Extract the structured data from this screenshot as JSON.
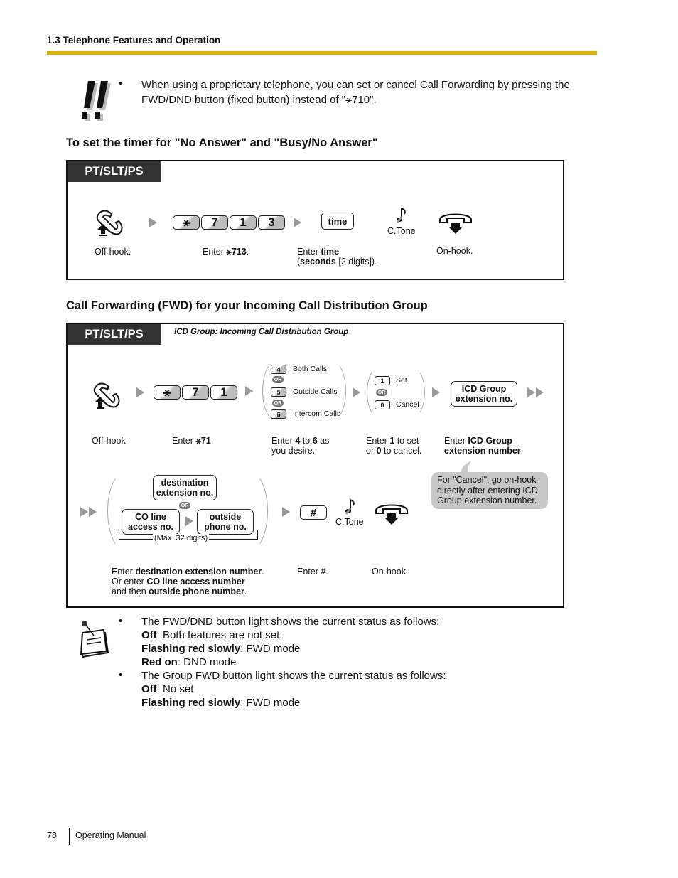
{
  "header": {
    "title": "1.3 Telephone Features and Operation",
    "accent_color": "#dbb400"
  },
  "notice": {
    "icon": "double-exclamation-icon",
    "bullet": "When using a proprietary telephone, you can set or cancel Call Forwarding by pressing the FWD/DND button (fixed button) instead of \"⚹710\"."
  },
  "section1": {
    "title": "To set the timer for \"No Answer\" and \"Busy/No Answer\"",
    "tag": "PT/SLT/PS",
    "keys": [
      "⚹",
      "7",
      "1",
      "3"
    ],
    "time_key": "time",
    "ctone": "C.Tone",
    "captions": {
      "offhook": "Off-hook.",
      "enter_prefix": "Enter ",
      "enter_code": "⚹713",
      "enter_suffix": ".",
      "time_line1_prefix": "Enter ",
      "time_line1_bold": "time",
      "time_line2_open": "(",
      "time_line2_bold": "seconds",
      "time_line2_rest": " [2 digits]).",
      "onhook": "On-hook."
    }
  },
  "section2": {
    "title": "Call Forwarding (FWD) for your Incoming Call Distribution Group",
    "tag": "PT/SLT/PS",
    "subtitle": "ICD Group: Incoming Call Distribution Group",
    "keys": [
      "⚹",
      "7",
      "1"
    ],
    "choice_options": [
      {
        "key": "4",
        "label": "Both Calls"
      },
      {
        "key": "5",
        "label": "Outside Calls"
      },
      {
        "key": "6",
        "label": "Intercom Calls"
      }
    ],
    "set_options": [
      {
        "key": "1",
        "label": "Set"
      },
      {
        "key": "0",
        "label": "Cancel"
      }
    ],
    "or_label": "OR",
    "icd_box": {
      "line1": "ICD Group",
      "line2": "extension no."
    },
    "dest_box": {
      "line1": "destination",
      "line2": "extension no."
    },
    "co_box": {
      "line1": "CO line",
      "line2": "access no."
    },
    "outside_box": {
      "line1": "outside",
      "line2": "phone no."
    },
    "max_digits": "(Max. 32 digits)",
    "hash_key": "#",
    "ctone": "C.Tone",
    "bubble": "For \"Cancel\", go on-hook directly after entering ICD Group extension number.",
    "captions": {
      "offhook": "Off-hook.",
      "enter_prefix": "Enter ",
      "enter_code": "⚹71",
      "enter_suffix": ".",
      "choice_a": "Enter ",
      "choice_b": "4",
      "choice_c": " to ",
      "choice_d": "6",
      "choice_e": " as",
      "choice_line2": "you desire.",
      "set_a": "Enter ",
      "set_b": "1",
      "set_c": " to set",
      "set_d": "or ",
      "set_e": "0",
      "set_f": " to cancel.",
      "icd_a": "Enter ",
      "icd_b": "ICD Group",
      "icd_c": "extension number",
      "icd_d": ".",
      "dest_a": "Enter ",
      "dest_b": "destination extension number",
      "dest_c": ".",
      "dest_d": "Or enter ",
      "dest_e": "CO line access number",
      "dest_f": "and then ",
      "dest_g": "outside phone number",
      "dest_h": ".",
      "hash": "Enter #.",
      "onhook": "On-hook."
    }
  },
  "notes": {
    "icon": "memo-note-icon",
    "items": [
      {
        "text": "The FWD/DND button light shows the current status as follows:",
        "states": [
          {
            "label": "Off",
            "desc": ": Both features are not set."
          },
          {
            "label": "Flashing red slowly",
            "desc": ": FWD mode"
          },
          {
            "label": "Red on",
            "desc": ": DND mode"
          }
        ]
      },
      {
        "text": "The Group FWD button light shows the current status as follows:",
        "states": [
          {
            "label": "Off",
            "desc": ": No set"
          },
          {
            "label": "Flashing red slowly",
            "desc": ": FWD mode"
          }
        ]
      }
    ]
  },
  "footer": {
    "page_number": "78",
    "manual": "Operating Manual"
  }
}
